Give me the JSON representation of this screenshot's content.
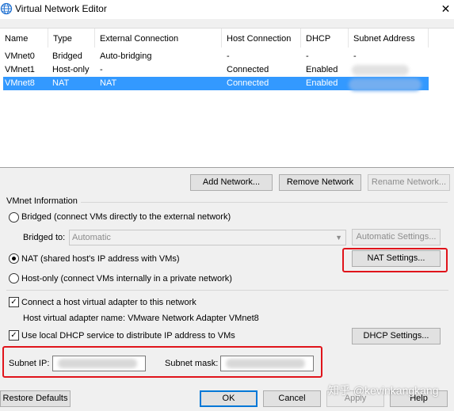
{
  "window": {
    "title": "Virtual Network Editor",
    "close_glyph": "✕"
  },
  "table": {
    "columns": [
      "Name",
      "Type",
      "External Connection",
      "Host Connection",
      "DHCP",
      "Subnet Address"
    ],
    "rows": [
      {
        "name": "VMnet0",
        "type": "Bridged",
        "external": "Auto-bridging",
        "host": "-",
        "dhcp": "-",
        "subnet": "-",
        "selected": false
      },
      {
        "name": "VMnet1",
        "type": "Host-only",
        "external": "-",
        "host": "Connected",
        "dhcp": "Enabled",
        "subnet": "",
        "selected": false
      },
      {
        "name": "VMnet8",
        "type": "NAT",
        "external": "NAT",
        "host": "Connected",
        "dhcp": "Enabled",
        "subnet": "",
        "selected": true
      }
    ]
  },
  "list_buttons": {
    "add": "Add Network...",
    "remove": "Remove Network",
    "rename": "Rename Network..."
  },
  "vmnet_info": {
    "label": "VMnet Information",
    "bridged_label": "Bridged (connect VMs directly to the external network)",
    "bridged_to_label": "Bridged to:",
    "bridged_to_value": "Automatic",
    "auto_settings": "Automatic Settings...",
    "nat_label": "NAT (shared host's IP address with VMs)",
    "nat_settings": "NAT Settings...",
    "hostonly_label": "Host-only (connect VMs internally in a private network)",
    "connect_adapter_label": "Connect a host virtual adapter to this network",
    "adapter_name_label": "Host virtual adapter name: VMware Network Adapter VMnet8",
    "dhcp_label": "Use local DHCP service to distribute IP address to VMs",
    "dhcp_settings": "DHCP Settings...",
    "subnet_ip_label": "Subnet IP:",
    "subnet_mask_label": "Subnet mask:",
    "mode": "NAT",
    "connect_adapter_checked": true,
    "dhcp_checked": true
  },
  "footer": {
    "restore": "Restore Defaults",
    "ok": "OK",
    "cancel": "Cancel",
    "apply": "Apply",
    "help": "Help"
  },
  "watermark": "知乎 @kevinkangkang",
  "colors": {
    "selection": "#3399ff",
    "highlight_box": "#e0141b"
  }
}
